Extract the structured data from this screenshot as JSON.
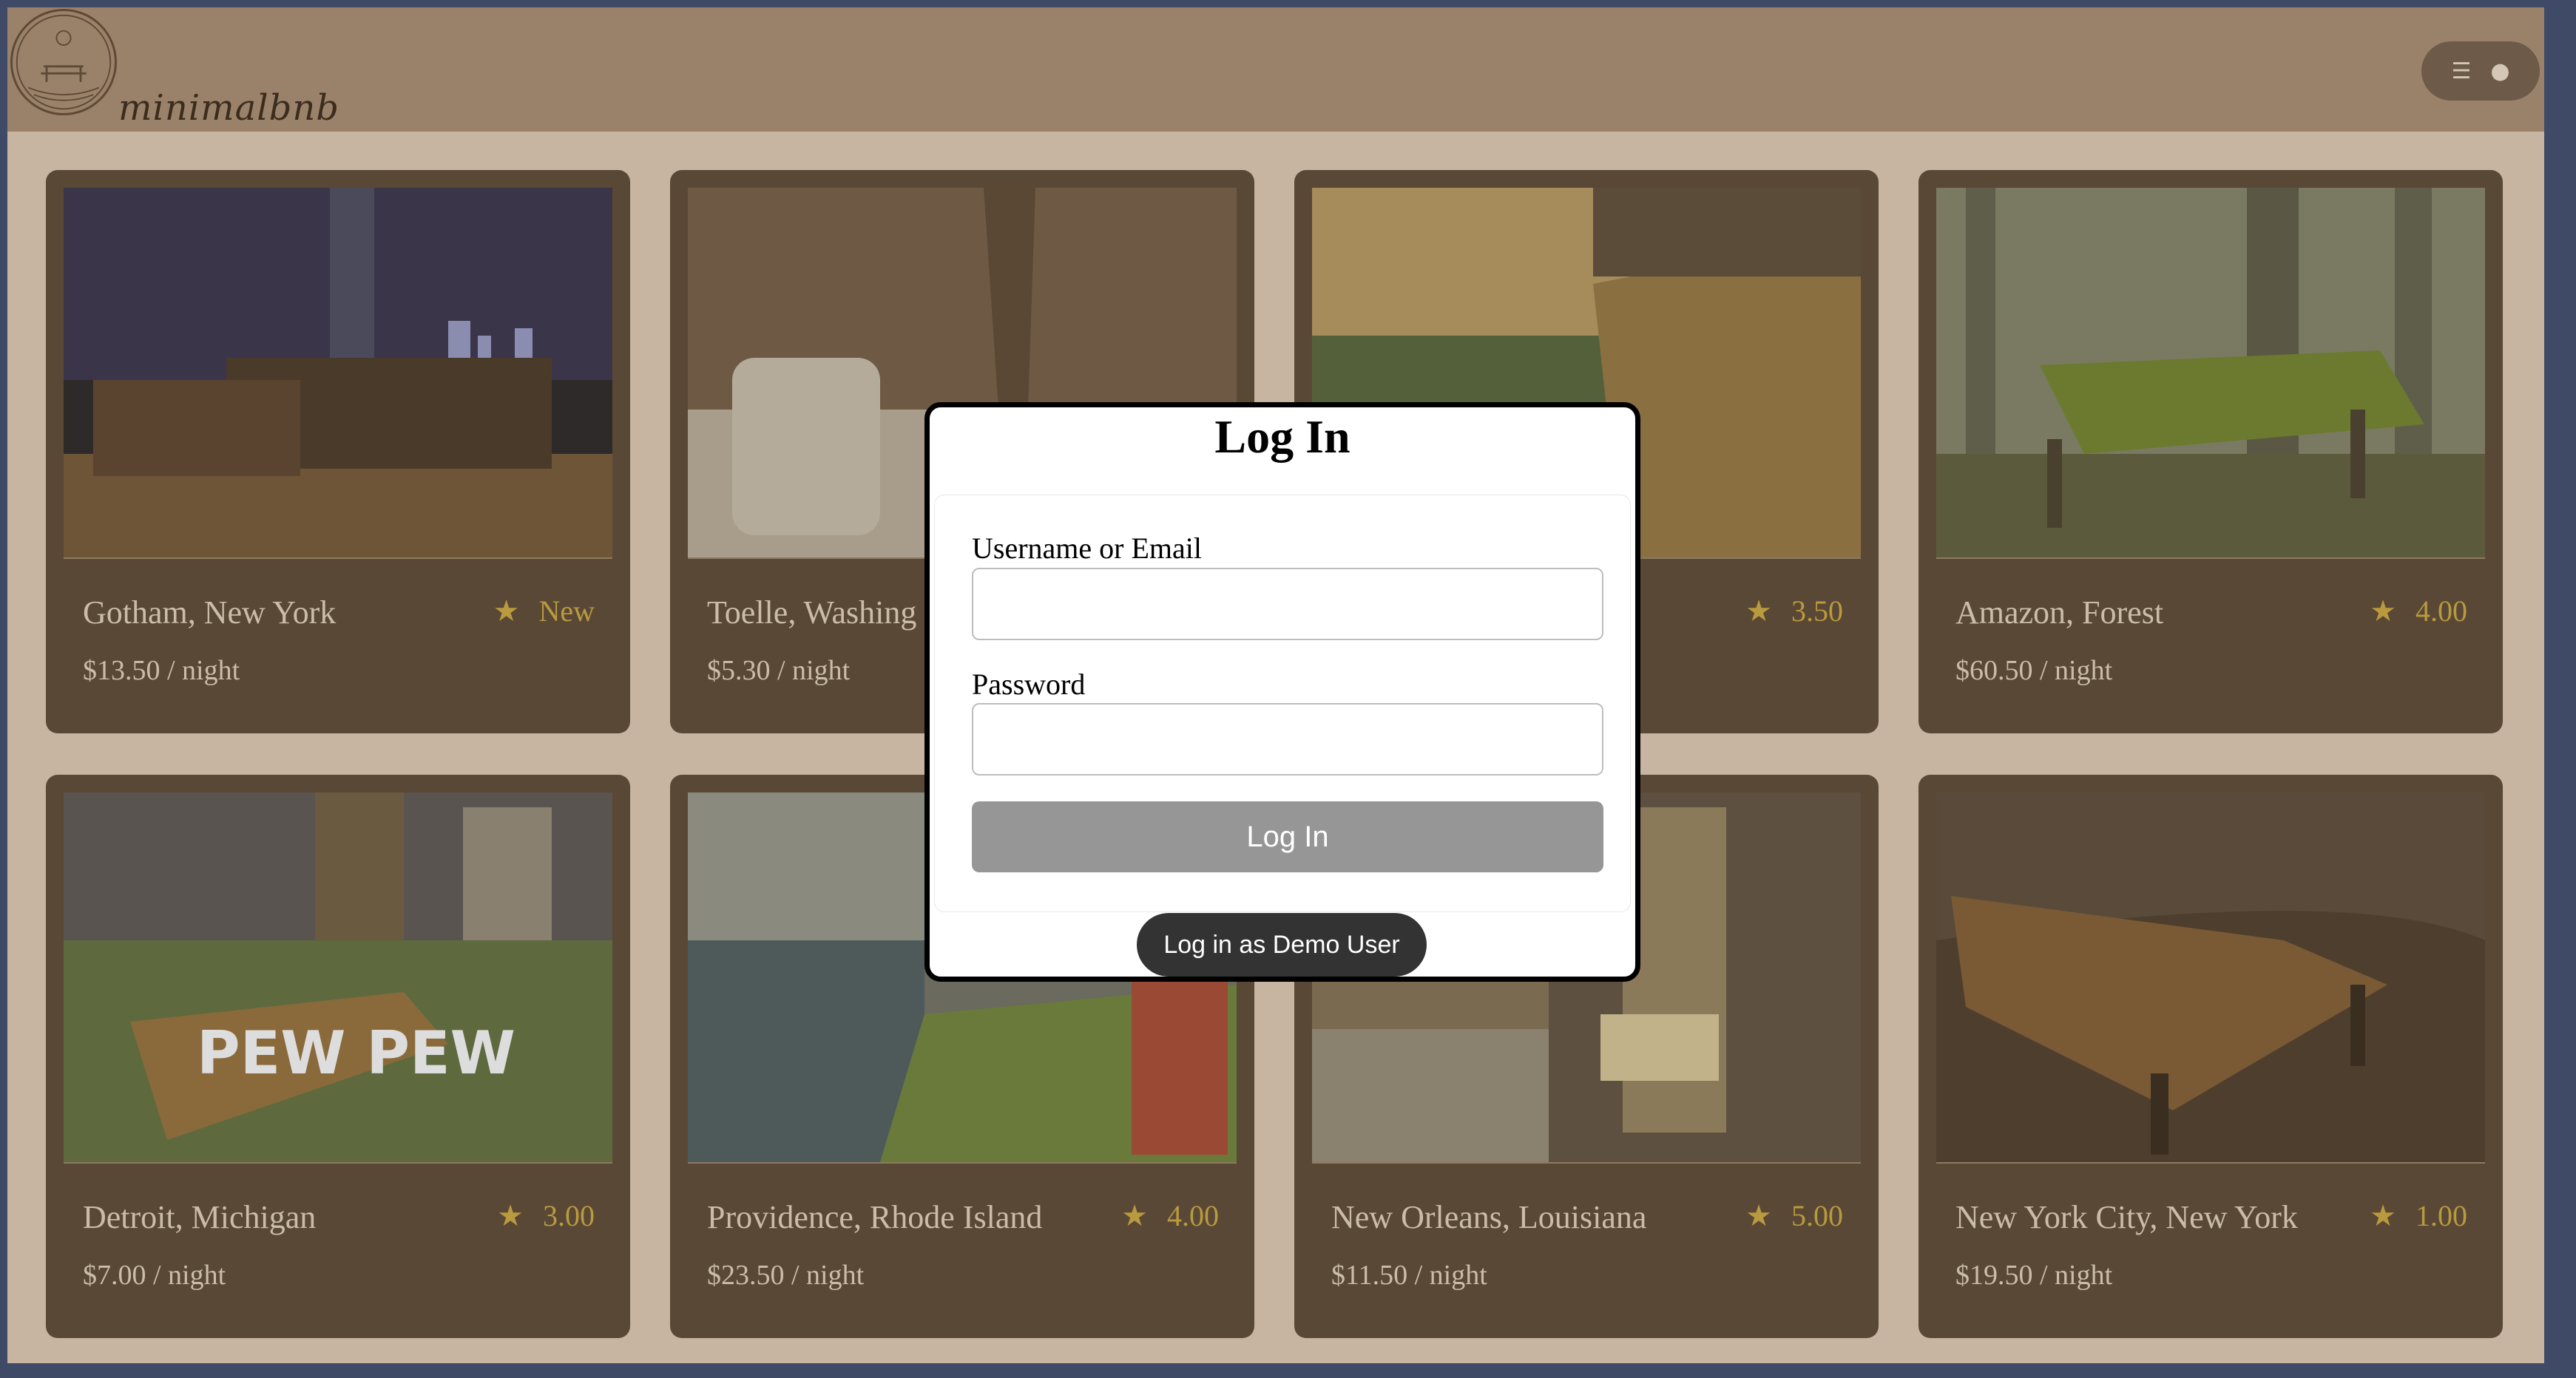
{
  "app": {
    "logo_text": "minimalbnb"
  },
  "header": {
    "menu_icon": "menu-icon",
    "user_icon": "user-icon"
  },
  "listings": [
    {
      "city": "Gotham, New York",
      "rating": "New",
      "price": "$13.50 / night"
    },
    {
      "city": "Toelle, Washing",
      "rating": "",
      "price": "$5.30 / night"
    },
    {
      "city": "",
      "rating": "3.50",
      "price": ""
    },
    {
      "city": "Amazon, Forest",
      "rating": "4.00",
      "price": "$60.50 / night"
    },
    {
      "city": "Detroit, Michigan",
      "rating": "3.00",
      "price": "$7.00 / night"
    },
    {
      "city": "Providence, Rhode Island",
      "rating": "4.00",
      "price": "$23.50 / night"
    },
    {
      "city": "New Orleans, Louisiana",
      "rating": "5.00",
      "price": "$11.50 / night"
    },
    {
      "city": "New York City, New York",
      "rating": "1.00",
      "price": "$19.50 / night"
    }
  ],
  "modal": {
    "title": "Log In",
    "username_label": "Username or Email",
    "username_value": "",
    "password_label": "Password",
    "password_value": "",
    "submit_label": "Log In",
    "demo_label": "Log in as Demo User"
  },
  "colors": {
    "header": "#9a826a",
    "card": "#5a4836",
    "rating": "#b99a3e",
    "page_bg": "#c7b5a2"
  }
}
